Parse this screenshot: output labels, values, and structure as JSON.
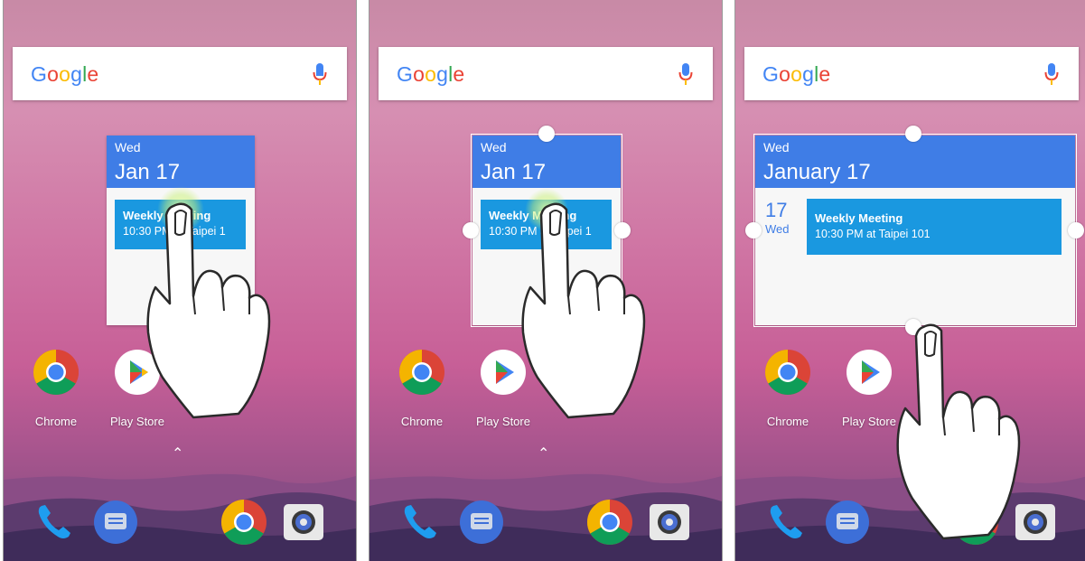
{
  "colors": {
    "google_blue": "#4285F4",
    "google_red": "#EA4335",
    "google_yellow": "#FBBC05",
    "google_green": "#34A853",
    "widget_header": "#3f7de6",
    "event_bg": "#1a98e0"
  },
  "search": {
    "logo": [
      "G",
      "o",
      "o",
      "g",
      "l",
      "e"
    ],
    "mic_icon": "mic-icon"
  },
  "panels": [
    {
      "widget": {
        "day": "Wed",
        "date": "Jan 17",
        "event_title": "Weekly Meeting",
        "event_time": "10:30 PM at Taipei 1"
      }
    },
    {
      "widget": {
        "day": "Wed",
        "date": "Jan 17",
        "event_title": "Weekly Meeting",
        "event_time": "10:30 PM at Taipei 1"
      }
    },
    {
      "widget": {
        "day": "Wed",
        "date": "January 17",
        "agenda_day_num": "17",
        "agenda_day_name": "Wed",
        "event_title": "Weekly Meeting",
        "event_time": "10:30 PM at Taipei 101"
      }
    }
  ],
  "apps": {
    "chrome": "Chrome",
    "play_store": "Play Store"
  },
  "app_drawer_icon": "chevron-up-icon",
  "dock": [
    "phone-icon",
    "messages-icon",
    "chrome-icon",
    "camera-icon"
  ]
}
